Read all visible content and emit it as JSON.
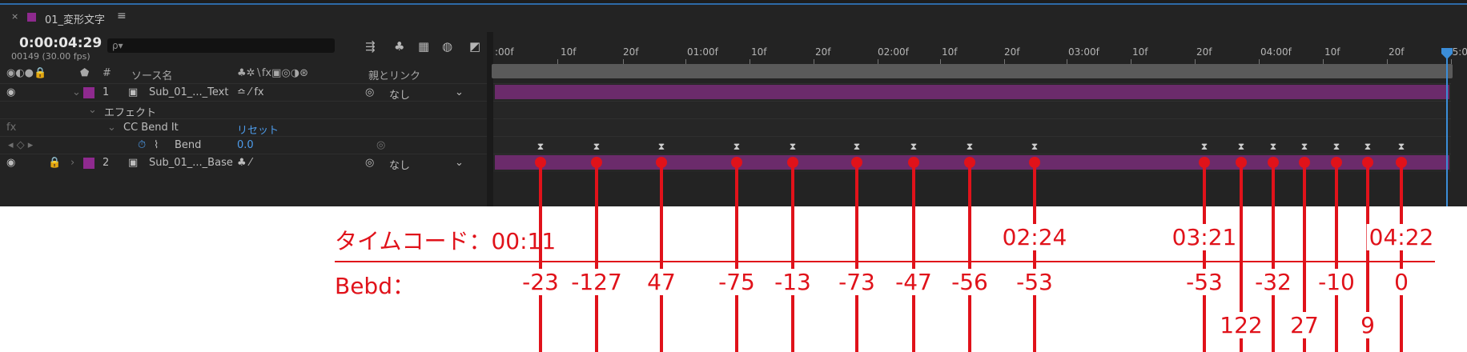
{
  "tab": {
    "close": "×",
    "title": "01_変形文字",
    "menu": "≡"
  },
  "header": {
    "timecode": "0:00:04:29",
    "fps": "00149 (30.00 fps)",
    "search_placeholder": "ρ▾"
  },
  "columns": {
    "source_name": "ソース名",
    "parent_link": "親とリンク",
    "index_col": "#"
  },
  "layers": [
    {
      "index": "1",
      "name": "Sub_01_..._Text",
      "parent": "なし"
    },
    {
      "index": "2",
      "name": "Sub_01_..._Base",
      "parent": "なし"
    }
  ],
  "effect": {
    "group_label": "エフェクト",
    "name": "CC Bend It",
    "reset": "リセット",
    "fx": "fx"
  },
  "property": {
    "name": "Bend",
    "value": "0.0"
  },
  "ruler": {
    "ticks": [
      ":00f",
      "10f",
      "20f",
      "01:00f",
      "10f",
      "20f",
      "02:00f",
      "10f",
      "20f",
      "03:00f",
      "10f",
      "20f",
      "04:00f",
      "10f",
      "20f",
      "05:00"
    ]
  },
  "annotations": {
    "timecode_label": "タイムコード：00:11",
    "bend_label": "Bebd：",
    "timecodes": [
      "02:24",
      "03:21",
      "04:22"
    ],
    "bend_values": [
      "-23",
      "-127",
      "47",
      "-75",
      "-13",
      "-73",
      "-47",
      "-56",
      "-53",
      "-53",
      "122",
      "-32",
      "27",
      "-10",
      "9",
      "0"
    ],
    "keyframe_glyph": "⧗",
    "color": "#e0121a"
  }
}
